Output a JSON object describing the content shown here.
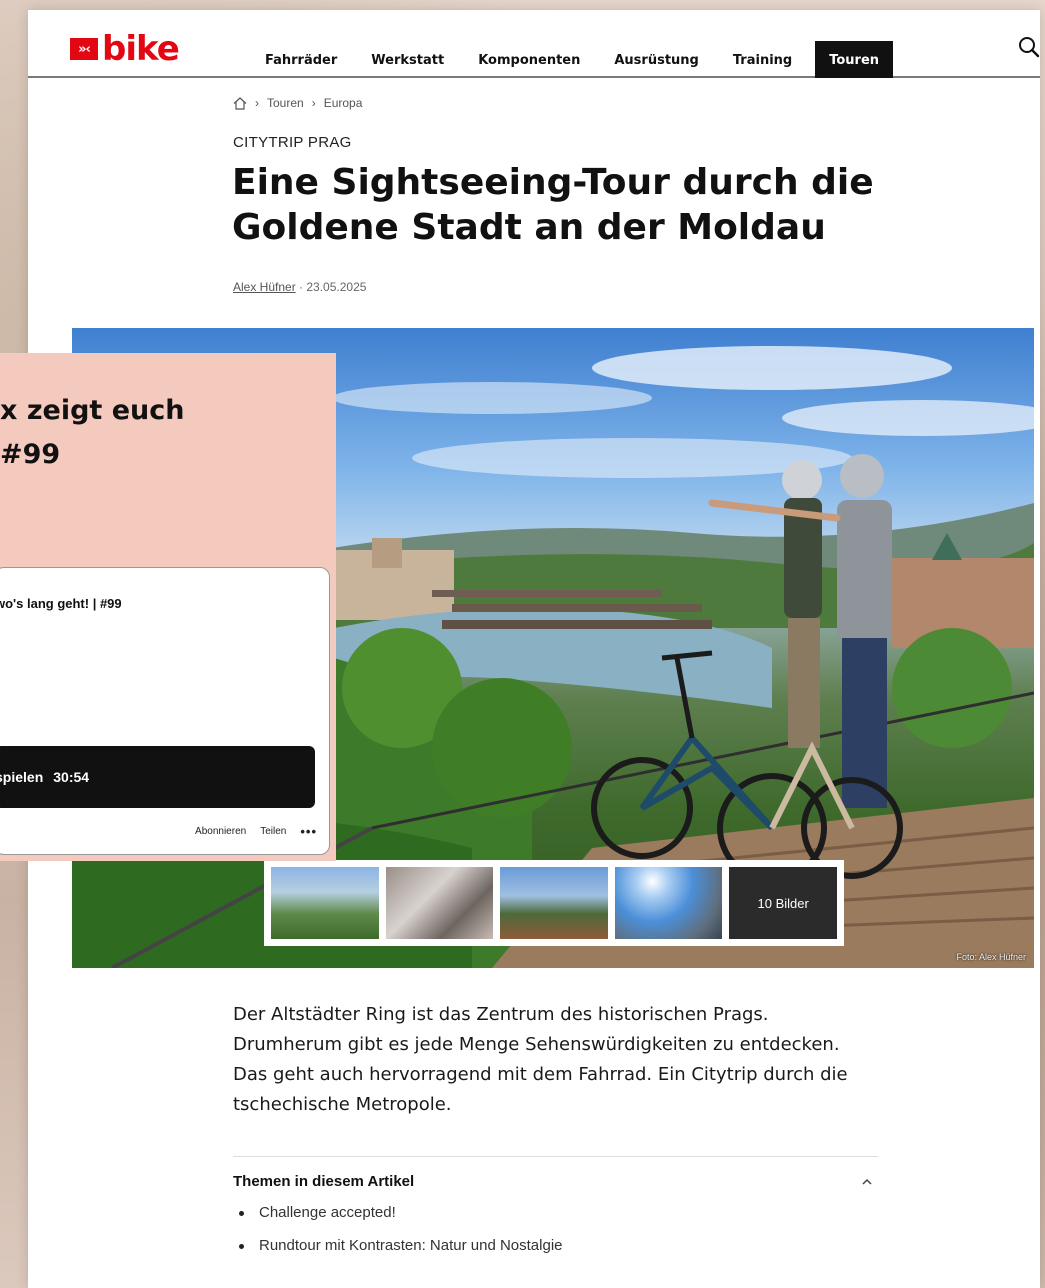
{
  "site": {
    "logo_mark": "»‹",
    "logo_text": "bike",
    "nav": [
      "Fahrräder",
      "Werkstatt",
      "Komponenten",
      "Ausrüstung",
      "Training",
      "Touren"
    ],
    "active_nav": "Touren"
  },
  "breadcrumb": [
    "Touren",
    "Europa"
  ],
  "article": {
    "kicker": "CITYTRIP PRAG",
    "headline": "Eine Sightseeing-Tour durch die Goldene Stadt an der Moldau",
    "author": "Alex Hüfner",
    "date": " · 23.05.2025",
    "gallery_more": "10 Bilder",
    "photo_credit": "Foto: Alex Hüfner",
    "lead": "Der Altstädter Ring ist das Zentrum des historischen Prags. Drumherum gibt es jede Menge Sehenswürdigkeiten zu entdecken. Das geht auch hervorragend mit dem Fahrrad. Ein Citytrip durch die tschechische Metropole.",
    "toc_title": "Themen in diesem Artikel",
    "toc_items": [
      "Challenge accepted!",
      "Rundtour mit Kontrasten: Natur und Nostalgie"
    ]
  },
  "podcast": {
    "promo_line1": "x zeigt euch",
    "promo_line2": "#99",
    "episode_title": "wo's lang geht! | #99",
    "play_label": "spielen",
    "duration": "30:54",
    "subscribe": "Abonnieren",
    "share": "Teilen",
    "more": "•••"
  },
  "colors": {
    "brand_red": "#e30613",
    "promo_pink": "#f4c9be",
    "nav_active_bg": "#111111"
  }
}
